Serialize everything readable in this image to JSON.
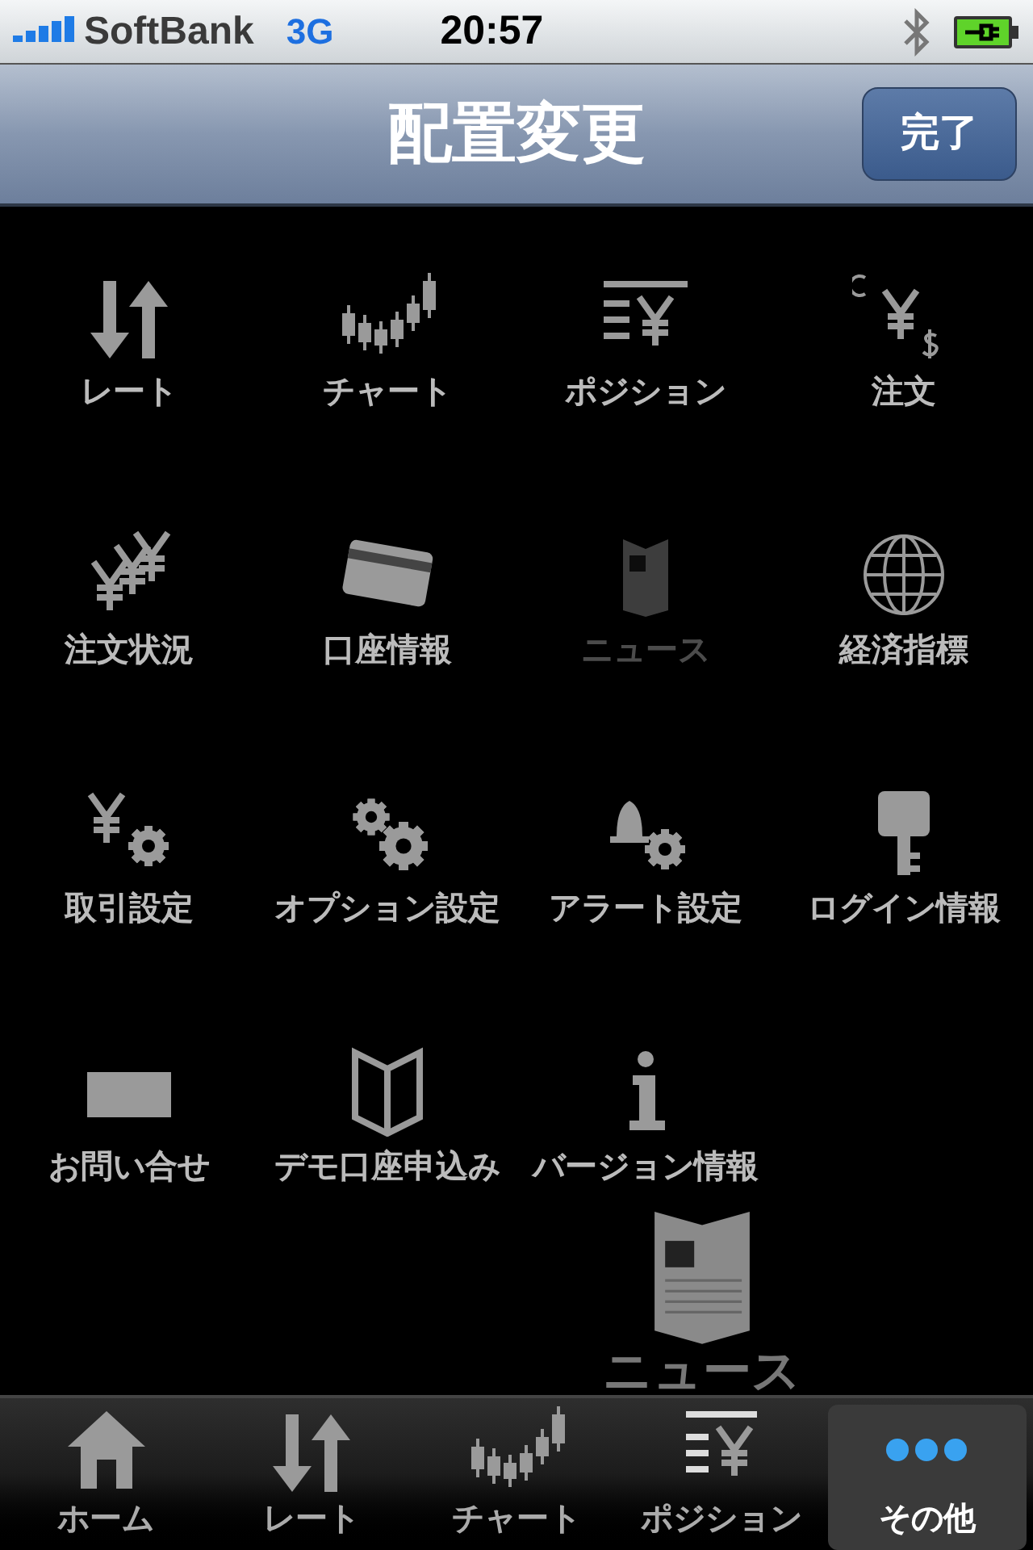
{
  "status_bar": {
    "carrier": "SoftBank",
    "network": "3G",
    "time": "20:57"
  },
  "nav_bar": {
    "title": "配置変更",
    "done_button": "完了"
  },
  "items": [
    {
      "label": "レート",
      "dimmed": false
    },
    {
      "label": "チャート",
      "dimmed": false
    },
    {
      "label": "ポジション",
      "dimmed": false
    },
    {
      "label": "注文",
      "dimmed": false
    },
    {
      "label": "注文状況",
      "dimmed": false
    },
    {
      "label": "口座情報",
      "dimmed": false
    },
    {
      "label": "ニュース",
      "dimmed": true
    },
    {
      "label": "経済指標",
      "dimmed": false
    },
    {
      "label": "取引設定",
      "dimmed": false
    },
    {
      "label": "オプション設定",
      "dimmed": false
    },
    {
      "label": "アラート設定",
      "dimmed": false
    },
    {
      "label": "ログイン情報",
      "dimmed": false
    },
    {
      "label": "お問い合せ",
      "dimmed": false
    },
    {
      "label": "デモ口座申込み",
      "dimmed": false
    },
    {
      "label": "バージョン情報",
      "dimmed": false
    }
  ],
  "dragged_item": {
    "label": "ニュース"
  },
  "tab_bar": [
    {
      "label": "ホーム",
      "selected": false
    },
    {
      "label": "レート",
      "selected": false
    },
    {
      "label": "チャート",
      "selected": false
    },
    {
      "label": "ポジション",
      "selected": false
    },
    {
      "label": "その他",
      "selected": true
    }
  ]
}
